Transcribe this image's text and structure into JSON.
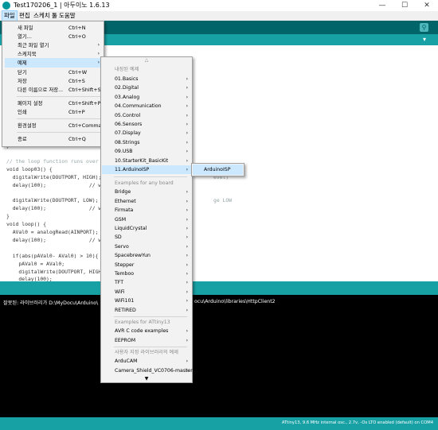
{
  "window": {
    "title": "Test170206_1 | 아두이노 1.6.13",
    "minimize": "—",
    "maximize": "☐",
    "close": "✕"
  },
  "menubar": [
    "파일",
    "편집",
    "스케치",
    "툴",
    "도움말"
  ],
  "toolbar": {
    "serial_monitor_icon": "magnifier-icon"
  },
  "file_menu": {
    "items": [
      {
        "label": "새 파일",
        "shortcut": "Ctrl+N"
      },
      {
        "label": "열기...",
        "shortcut": "Ctrl+O"
      },
      {
        "label": "최근 파일 열기",
        "shortcut": "",
        "submenu": true
      },
      {
        "label": "스케치북",
        "shortcut": "",
        "submenu": true
      },
      {
        "label": "예제",
        "shortcut": "",
        "submenu": true,
        "highlighted": true
      },
      {
        "label": "닫기",
        "shortcut": "Ctrl+W"
      },
      {
        "label": "저장",
        "shortcut": "Ctrl+S"
      },
      {
        "label": "다른 이름으로 저장...",
        "shortcut": "Ctrl+Shift+S"
      },
      {
        "label": "페이지 설정",
        "shortcut": "Ctrl+Shift+P"
      },
      {
        "label": "인쇄",
        "shortcut": "Ctrl+P"
      },
      {
        "label": "환경설정",
        "shortcut": "Ctrl+Comma"
      },
      {
        "label": "종료",
        "shortcut": "Ctrl+Q"
      }
    ]
  },
  "examples_menu": {
    "up_arrow": "△",
    "down_arrow": "▼",
    "items": [
      {
        "label": "내장된 예제",
        "header": true
      },
      {
        "label": "01.Basics",
        "submenu": true
      },
      {
        "label": "02.Digital",
        "submenu": true
      },
      {
        "label": "03.Analog",
        "submenu": true
      },
      {
        "label": "04.Communication",
        "submenu": true
      },
      {
        "label": "05.Control",
        "submenu": true
      },
      {
        "label": "06.Sensors",
        "submenu": true
      },
      {
        "label": "07.Display",
        "submenu": true
      },
      {
        "label": "08.Strings",
        "submenu": true
      },
      {
        "label": "09.USB",
        "submenu": true
      },
      {
        "label": "10.StarterKit_BasicKit",
        "submenu": true
      },
      {
        "label": "11.ArduinoISP",
        "submenu": true,
        "highlighted": true
      },
      {
        "label": "Examples for any board",
        "header": true
      },
      {
        "label": "Bridge",
        "submenu": true
      },
      {
        "label": "Ethernet",
        "submenu": true
      },
      {
        "label": "Firmata",
        "submenu": true
      },
      {
        "label": "GSM",
        "submenu": true
      },
      {
        "label": "LiquidCrystal",
        "submenu": true
      },
      {
        "label": "SD",
        "submenu": true
      },
      {
        "label": "Servo",
        "submenu": true
      },
      {
        "label": "SpacebrewYun",
        "submenu": true
      },
      {
        "label": "Stepper",
        "submenu": true
      },
      {
        "label": "Temboo",
        "submenu": true
      },
      {
        "label": "TFT",
        "submenu": true
      },
      {
        "label": "WiFi",
        "submenu": true
      },
      {
        "label": "WiFi101",
        "submenu": true
      },
      {
        "label": "RETIRED",
        "submenu": true
      },
      {
        "label": "Examples for ATtiny13",
        "header": true
      },
      {
        "label": "AVR C code examples",
        "submenu": true
      },
      {
        "label": "EEPROM",
        "submenu": true
      },
      {
        "label": "사용자 지정 라이브러리의 예제",
        "header": true
      },
      {
        "label": "ArduCAM",
        "submenu": true
      },
      {
        "label": "Camera_Shield_VC0706-master",
        "submenu": true
      }
    ]
  },
  "isp_submenu": {
    "item": "ArduinoISP"
  },
  "editor": {
    "lines": [
      "}",
      "",
      "// the loop function runs over and over",
      "void loop03() {",
      "  digitalWrite(DOUTPORT, HIGH); // t",
      "  delay(100);              // wait for",
      "",
      "  digitalWrite(DOUTPORT, LOW);   //",
      "  delay(100);              // wait for",
      "}",
      "void loop() {",
      "  AVal0 = analogRead(AINPORT);",
      "  delay(100);              // wait for",
      "",
      "  if(abs(pAVal0- AVal0) > 10){",
      "    pAVal0 = AVal0;",
      "    digitalWrite(DOUTPORT, HIGH);",
      "    delay(100);"
    ],
    "fragments": {
      "line4_tail": "evel)",
      "line7_tail": "ge LOW"
    }
  },
  "console": {
    "message": "잘못된: 라이브러리가 D:\\MyDocu\\Arduino\\",
    "message_tail": "ocu\\Arduino\\libraries\\HttpClient2"
  },
  "footer": {
    "line_number": "",
    "board_info": "ATtiny13, 9.6 MHz internal osc., 2.7v, -Os LTO enabled (default) on COM4"
  },
  "colors": {
    "toolbar": "#006468",
    "tabs": "#17a1a5",
    "highlight": "#cce8ff"
  }
}
